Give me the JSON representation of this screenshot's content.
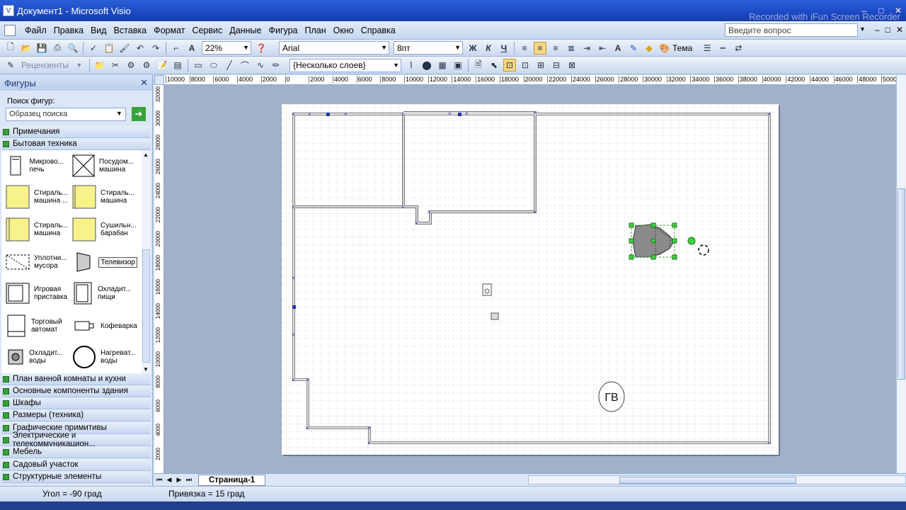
{
  "window": {
    "title": "Документ1 - Microsoft Visio",
    "watermark": "Recorded with iFun Screen Recorder",
    "minimize": "–",
    "maximize": "□",
    "close": "✕"
  },
  "menu": {
    "items": [
      "Файл",
      "Правка",
      "Вид",
      "Вставка",
      "Формат",
      "Сервис",
      "Данные",
      "Фигура",
      "План",
      "Окно",
      "Справка"
    ],
    "ask_placeholder": "Введите вопрос"
  },
  "toolbar1": {
    "zoom": "22%",
    "font": "Arial",
    "font_size": "8пт",
    "bold": "Ж",
    "italic": "К",
    "underline": "Ч",
    "theme": "Тема"
  },
  "toolbar2": {
    "reviewers": "Рецензенты",
    "layers": "{Несколько слоев}"
  },
  "shapes_panel": {
    "title": "Фигуры",
    "search_label": "Поиск фигур:",
    "search_value": "Образец поиска",
    "stencils_top": [
      "Примечания",
      "Бытовая техника"
    ],
    "items": [
      {
        "label": "Микрово... печь",
        "icon": "microwave-icon"
      },
      {
        "label": "Посудом... машина",
        "icon": "dishwasher-icon"
      },
      {
        "label": "Стираль... машина ...",
        "icon": "washer-icon"
      },
      {
        "label": "Стираль... машина",
        "icon": "washer-icon"
      },
      {
        "label": "Стираль... машина",
        "icon": "washer-icon"
      },
      {
        "label": "Сушильн... барабан",
        "icon": "dryer-icon"
      },
      {
        "label": "Уплотни... мусора",
        "icon": "compactor-icon"
      },
      {
        "label": "Телевизор",
        "icon": "tv-icon"
      },
      {
        "label": "Игровая приставка",
        "icon": "console-icon"
      },
      {
        "label": "Охладит... пищи",
        "icon": "fridge-icon"
      },
      {
        "label": "Торговый автомат",
        "icon": "vending-icon"
      },
      {
        "label": "Кофеварка",
        "icon": "coffee-icon"
      },
      {
        "label": "Охладит... воды",
        "icon": "water-cooler-icon"
      },
      {
        "label": "Нагреват... воды",
        "icon": "water-heater-icon"
      }
    ],
    "stencils_bottom": [
      "План ванной комнаты и кухни",
      "Основные компоненты здания",
      "Шкафы",
      "Размеры (техника)",
      "Графические примитивы",
      "Электрические и телекоммуникацион...",
      "Мебель",
      "Садовый участок",
      "Структурные элементы"
    ]
  },
  "ruler": {
    "h_ticks": [
      "10000",
      "8000",
      "6000",
      "4000",
      "2000",
      "0",
      "2000",
      "4000",
      "6000",
      "8000",
      "10000",
      "12000",
      "14000",
      "16000",
      "18000",
      "20000",
      "22000",
      "24000",
      "26000",
      "28000",
      "30000",
      "32000",
      "34000",
      "36000",
      "38000",
      "40000",
      "42000",
      "44000",
      "46000",
      "48000",
      "50000"
    ],
    "v_ticks": [
      "32000",
      "30000",
      "28000",
      "26000",
      "24000",
      "22000",
      "20000",
      "18000",
      "16000",
      "14000",
      "12000",
      "10000",
      "8000",
      "6000",
      "4000",
      "2000"
    ]
  },
  "drawing": {
    "label_gv": "ГВ"
  },
  "tabs": {
    "page": "Страница-1"
  },
  "status": {
    "angle": "Угол = -90 град",
    "snap": "Привязка = 15 град"
  }
}
